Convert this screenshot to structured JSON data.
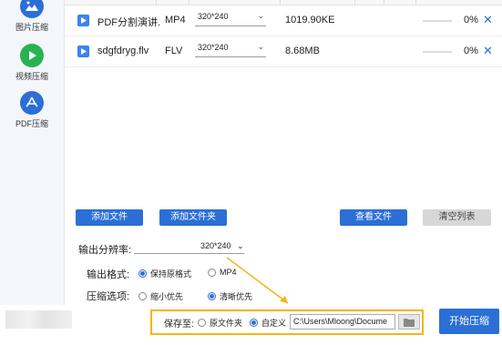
{
  "sidebar": {
    "items": [
      {
        "label": "图片压缩",
        "icon": "image-icon"
      },
      {
        "label": "视频压缩",
        "icon": "play-icon"
      },
      {
        "label": "PDF压缩",
        "icon": "pdf-icon"
      }
    ]
  },
  "files": [
    {
      "name": "PDF分割演讲...",
      "format": "MP4",
      "resolution": "320*240",
      "size": "1019.90KE",
      "progress_pct": 0,
      "progress_text": "0%"
    },
    {
      "name": "sdgfdryg.flv",
      "format": "FLV",
      "resolution": "320*240",
      "size": "8.68MB",
      "progress_pct": 0,
      "progress_text": "0%"
    }
  ],
  "buttons": {
    "add_file": "添加文件",
    "add_folder": "添加文件夹",
    "view_file": "查看文件",
    "clear_list": "清空列表",
    "start": "开始压缩"
  },
  "settings": {
    "resolution_label": "输出分辨率:",
    "resolution_value": "320*240",
    "format_label": "输出格式:",
    "format_options": [
      "保持原格式",
      "MP4"
    ],
    "format_selected": 0,
    "compress_label": "压缩选项:",
    "compress_options": [
      "缩小优先",
      "清晰优先"
    ],
    "compress_selected": 1
  },
  "save": {
    "label": "保存至:",
    "options": [
      "原文件夹",
      "自定义"
    ],
    "selected": 1,
    "path": "C:\\Users\\Mloong\\Docume"
  },
  "colors": {
    "accent": "#2b6fd6",
    "active_nav": "#27b351",
    "highlight": "#f6b417"
  }
}
